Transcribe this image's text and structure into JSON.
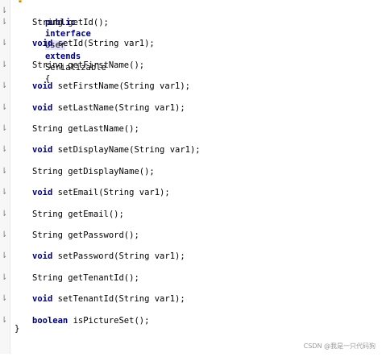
{
  "header": {
    "kw_public": "public",
    "kw_interface": "interface",
    "name": "User",
    "kw_extends": "extends",
    "parent": "Serializable",
    "brace": "{"
  },
  "methods": [
    {
      "ret": "String",
      "sig": "getId();"
    },
    {
      "ret": "void",
      "sig": "setId(String var1);"
    },
    {
      "ret": "String",
      "sig": "getFirstName();"
    },
    {
      "ret": "void",
      "sig": "setFirstName(String var1);"
    },
    {
      "ret": "void",
      "sig": "setLastName(String var1);"
    },
    {
      "ret": "String",
      "sig": "getLastName();"
    },
    {
      "ret": "void",
      "sig": "setDisplayName(String var1);"
    },
    {
      "ret": "String",
      "sig": "getDisplayName();"
    },
    {
      "ret": "void",
      "sig": "setEmail(String var1);"
    },
    {
      "ret": "String",
      "sig": "getEmail();"
    },
    {
      "ret": "String",
      "sig": "getPassword();"
    },
    {
      "ret": "void",
      "sig": "setPassword(String var1);"
    },
    {
      "ret": "String",
      "sig": "getTenantId();"
    },
    {
      "ret": "void",
      "sig": "setTenantId(String var1);"
    },
    {
      "ret": "boolean",
      "sig": "isPictureSet();"
    }
  ],
  "closing_brace": "}",
  "watermark": "CSDN @我是一只代码狗",
  "colors": {
    "keyword": "#000080",
    "highlight": "#e4e4ff",
    "marker": "#7a7a7a"
  }
}
